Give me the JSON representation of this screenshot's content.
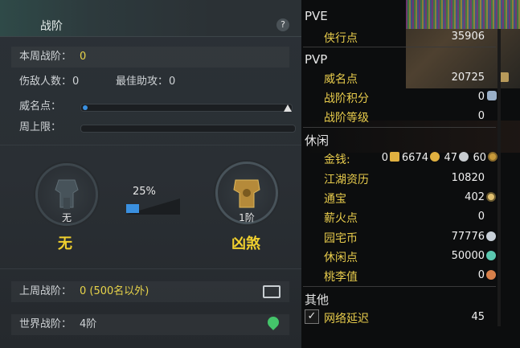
{
  "left": {
    "title": "战阶",
    "help": "?",
    "week_rank_label": "本周战阶：",
    "week_rank_value": "0",
    "kills_label": "伤敌人数：",
    "kills_value": "0",
    "best_assist_label": "最佳助攻：",
    "best_assist_value": "0",
    "prestige_label": "威名点：",
    "prestige_progress": 0.02,
    "weekly_cap_label": "周上限：",
    "weekly_cap_progress": 0,
    "current_tier_caption": "无",
    "current_tier_name": "无",
    "progress_percent": "25%",
    "next_tier_caption": "1阶",
    "next_tier_name": "凶煞",
    "last_week_label": "上周战阶：",
    "last_week_value": "0 (500名以外)",
    "world_label": "世界战阶：",
    "world_value": "4阶"
  },
  "right": {
    "sections": {
      "pve": "PVE",
      "pvp": "PVP",
      "leisure": "休闲",
      "other": "其他"
    },
    "pve_items": [
      {
        "label": "侠行点",
        "value": "35906"
      }
    ],
    "pvp_items": [
      {
        "label": "威名点",
        "value": "20725"
      },
      {
        "label": "战阶积分",
        "value": "0"
      },
      {
        "label": "战阶等级",
        "value": "0"
      }
    ],
    "money": {
      "label": "金钱:",
      "gold_bar": "0",
      "gold": "6674",
      "silver": "47",
      "copper": "60"
    },
    "leisure_items": [
      {
        "label": "江湖资历",
        "value": "10820"
      },
      {
        "label": "通宝",
        "value": "402"
      },
      {
        "label": "薪火点",
        "value": "0"
      },
      {
        "label": "园宅币",
        "value": "77776"
      },
      {
        "label": "休闲点",
        "value": "50000"
      },
      {
        "label": "桃李值",
        "value": "0"
      }
    ],
    "other_items": [
      {
        "label": "网络延迟",
        "value": "45",
        "checked": true
      }
    ],
    "colors": {
      "label": "#e8cc4c",
      "accent_blue": "#3a90e0",
      "highlight": "#f0d02e"
    }
  }
}
